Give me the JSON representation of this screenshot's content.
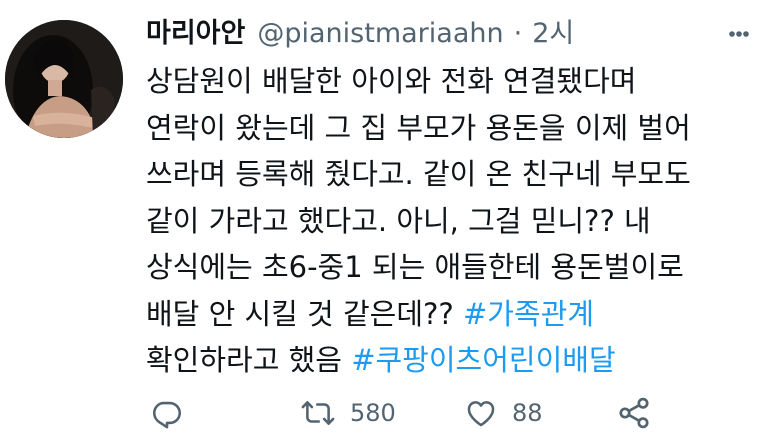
{
  "tweet": {
    "author_name": "마리아안",
    "handle": "@pianistmariaahn",
    "separator": "·",
    "time": "2시",
    "more_icon": "more-dots-icon",
    "lines": [
      {
        "text": "상담원이 배달한 아이와 전화 연결됐다며"
      },
      {
        "text": "연락이 왔는데 그 집 부모가 용돈을 이제 벌어"
      },
      {
        "text": "쓰라며 등록해 줬다고. 같이 온 친구네 부모도"
      },
      {
        "text": "같이 가라고 했다고. 아니, 그걸 믿니?? 내"
      },
      {
        "text": "상식에는 초6-중1 되는 애들한테 용돈벌이로"
      },
      {
        "text": "배달 안 시킬 것 같은데?? ",
        "hashtag": "#가족관계"
      },
      {
        "text": "확인하라고 했음 ",
        "hashtag": "#쿠팡이츠어린이배달"
      }
    ],
    "hashtag_color": "#1d9bf0",
    "actions": {
      "reply_icon": "reply-icon",
      "retweet_icon": "retweet-icon",
      "retweet_count": "580",
      "like_icon": "heart-icon",
      "like_count": "88",
      "share_icon": "share-icon"
    }
  }
}
